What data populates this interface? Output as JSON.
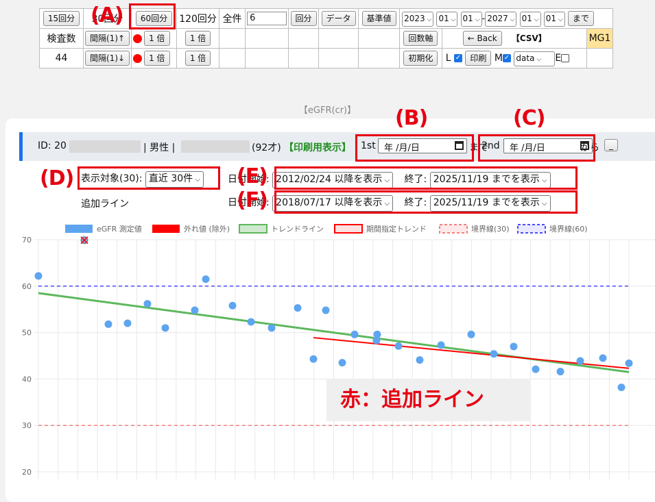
{
  "toolbar": {
    "btn_15": "15回分",
    "text_30": "30回分",
    "btn_60": "60回分",
    "text_120": "120回分",
    "text_all": "全件",
    "count_value": "6",
    "btn_kaibun": "回分",
    "btn_data": "データ",
    "btn_kijun": "基準値",
    "start_year": "2023",
    "start_month": "01",
    "start_day": "01",
    "sep": "-",
    "end_year": "2027",
    "end_month": "01",
    "end_day": "01",
    "btn_made": "まで",
    "kensa_label": "検査数",
    "kensa_count": "44",
    "btn_interval_up": "間隔(1)↑",
    "btn_interval_down": "間隔(1)↓",
    "btn_1x_a": "1 倍",
    "btn_1x_b": "1 倍",
    "btn_1x_c": "1 倍",
    "btn_1x_d": "1 倍",
    "btn_kaisuujiku": "回数軸",
    "btn_back": "← Back",
    "csv": "【CSV】",
    "mg1": "MG1",
    "btn_init": "初期化",
    "l_label": "L",
    "btn_print": "印刷",
    "m_label": "M",
    "data_select": "data",
    "e_label": "E"
  },
  "annotations": {
    "A": "(A)",
    "B": "(B)",
    "C": "(C)",
    "D": "(D)",
    "E": "(E)",
    "F": "(F)",
    "note": "赤：追加ライン"
  },
  "egfr_title": "【eGFR(cr)】",
  "id_bar": {
    "id_prefix": "ID: 20",
    "sex": "| 男性 |",
    "age": "(92才)",
    "print_link": "【印刷用表示】",
    "first": "1st",
    "date_placeholder": "年 /月/日",
    "made": "まで",
    "second": "2nd",
    "kara": "から",
    "underscore_btn": "_"
  },
  "filters": {
    "target_label": "表示対象(30):",
    "target_select": "直近 30件",
    "start_label_1": "日付開始:",
    "start_select_1": "2012/02/24 以降を表示",
    "end_label_1": "終了:",
    "end_select_1": "2025/11/19 までを表示",
    "extra_line_label": "追加ライン",
    "start_label_2": "日付開始:",
    "start_select_2": "2018/07/17 以降を表示",
    "end_label_2": "終了:",
    "end_select_2": "2025/11/19 までを表示"
  },
  "colors": {
    "egfr": "#5ea5f0",
    "outlier": "#ff0000",
    "trend": "#5cb85c",
    "period_trend": "#ff0000",
    "boundary30": "#f08080",
    "boundary60": "#4a4aff",
    "annotation": "#e60012"
  },
  "chart_data": {
    "type": "scatter",
    "legend": [
      "eGFR 測定値",
      "外れ値 (除外)",
      "トレンドライン",
      "期間指定トレンド",
      "境界線(30)",
      "境界線(60)"
    ],
    "legend_position": "top",
    "ylim": [
      20,
      70
    ],
    "yticks": [
      70,
      60,
      50,
      40,
      30,
      20
    ],
    "grid": true,
    "series": [
      {
        "name": "eGFR 測定値",
        "values": [
          62.2,
          51.8,
          52.0,
          56.2,
          51.0,
          54.8,
          61.5,
          55.8,
          52.3,
          51.0,
          55.3,
          44.3,
          54.8,
          43.5,
          49.6,
          48.3,
          49.6,
          47.1,
          44.1,
          47.3,
          49.6,
          45.4,
          47.0,
          42.1,
          41.6,
          43.9,
          44.5,
          38.2,
          43.4
        ]
      },
      {
        "name": "外れ値 (除外)",
        "values": [
          69.9
        ]
      }
    ],
    "trendline": [
      58.5,
      41.5
    ],
    "period_trend": [
      48.9,
      42.3
    ],
    "boundaries": [
      30,
      60
    ]
  }
}
